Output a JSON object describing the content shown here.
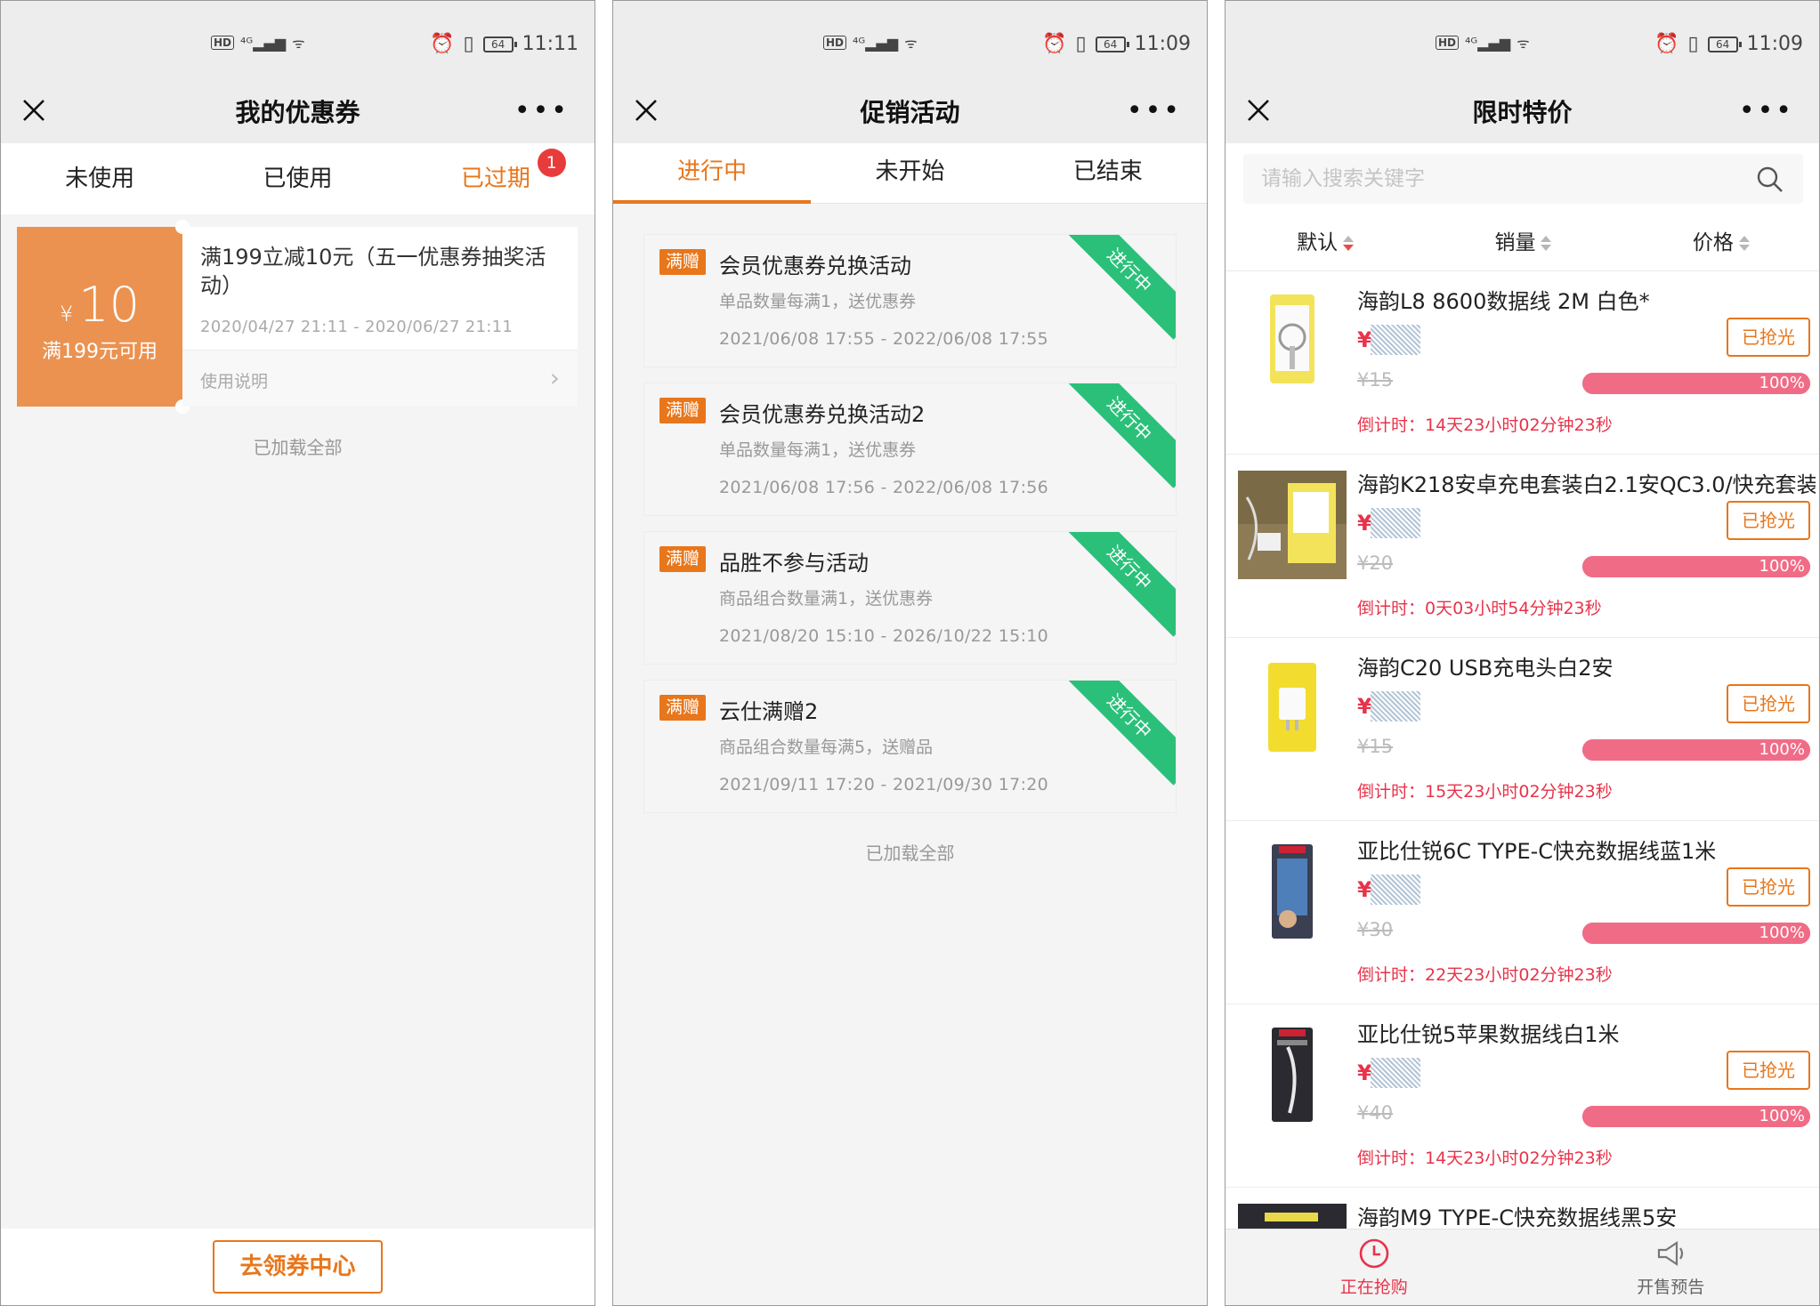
{
  "status_bars": [
    {
      "time": "11:11",
      "battery": "64"
    },
    {
      "time": "11:09",
      "battery": "64"
    },
    {
      "time": "11:09",
      "battery": "64"
    }
  ],
  "screen1": {
    "title": "我的优惠券",
    "tabs": [
      "未使用",
      "已使用",
      "已过期"
    ],
    "badge_count": "1",
    "coupon": {
      "currency": "¥",
      "amount": "10",
      "condition": "满199元可用",
      "title": "满199立减10元（五一优惠券抽奖活动）",
      "date_range": "2020/04/27 21:11 - 2020/06/27 21:11",
      "usage_label": "使用说明"
    },
    "loaded_text": "已加载全部",
    "claim_button": "去领券中心"
  },
  "screen2": {
    "title": "促销活动",
    "tabs": [
      "进行中",
      "未开始",
      "已结束"
    ],
    "promotions": [
      {
        "tag": "满赠",
        "title": "会员优惠券兑换活动",
        "desc": "单品数量每满1，送优惠券",
        "date": "2021/06/08 17:55 - 2022/06/08 17:55",
        "ribbon": "进行中"
      },
      {
        "tag": "满赠",
        "title": "会员优惠券兑换活动2",
        "desc": "单品数量每满1，送优惠券",
        "date": "2021/06/08 17:56 - 2022/06/08 17:56",
        "ribbon": "进行中"
      },
      {
        "tag": "满赠",
        "title": "品胜不参与活动",
        "desc": "商品组合数量满1，送优惠券",
        "date": "2021/08/20 15:10 - 2026/10/22 15:10",
        "ribbon": "进行中"
      },
      {
        "tag": "满赠",
        "title": "云仕满赠2",
        "desc": "商品组合数量每满5，送赠品",
        "date": "2021/09/11 17:20 - 2021/09/30 17:20",
        "ribbon": "进行中"
      }
    ],
    "loaded_text": "已加载全部"
  },
  "screen3": {
    "title": "限时特价",
    "search_placeholder": "请输入搜索关键字",
    "sort": [
      "默认",
      "销量",
      "价格"
    ],
    "products": [
      {
        "name": "海韵L8 8600数据线 2M 白色*",
        "price_prefix": "¥",
        "original": "¥15",
        "button": "已抢光",
        "progress": "100%",
        "countdown": "倒计时：14天23小时02分钟23秒"
      },
      {
        "name": "海韵K218安卓充电套装白2.1安QC3.0/快充套装",
        "price_prefix": "¥",
        "original": "¥20",
        "button": "已抢光",
        "progress": "100%",
        "countdown": "倒计时：0天03小时54分钟23秒"
      },
      {
        "name": "海韵C20 USB充电头白2安",
        "price_prefix": "¥",
        "original": "¥15",
        "button": "已抢光",
        "progress": "100%",
        "countdown": "倒计时：15天23小时02分钟23秒"
      },
      {
        "name": "亚比仕锐6C TYPE-C快充数据线蓝1米",
        "price_prefix": "¥",
        "original": "¥30",
        "button": "已抢光",
        "progress": "100%",
        "countdown": "倒计时：22天23小时02分钟23秒"
      },
      {
        "name": "亚比仕锐5苹果数据线白1米",
        "price_prefix": "¥",
        "original": "¥40",
        "button": "已抢光",
        "progress": "100%",
        "countdown": "倒计时：14天23小时02分钟23秒"
      },
      {
        "name": "海韵M9 TYPE-C快充数据线黑5安"
      }
    ],
    "nav": [
      "正在抢购",
      "开售预告"
    ]
  },
  "colors": {
    "accent_orange": "#e8761b",
    "price_red": "#e8334a",
    "ribbon_green": "#2bc07a",
    "coupon_orange": "#eb9250",
    "progress_pink": "#f06c86"
  }
}
